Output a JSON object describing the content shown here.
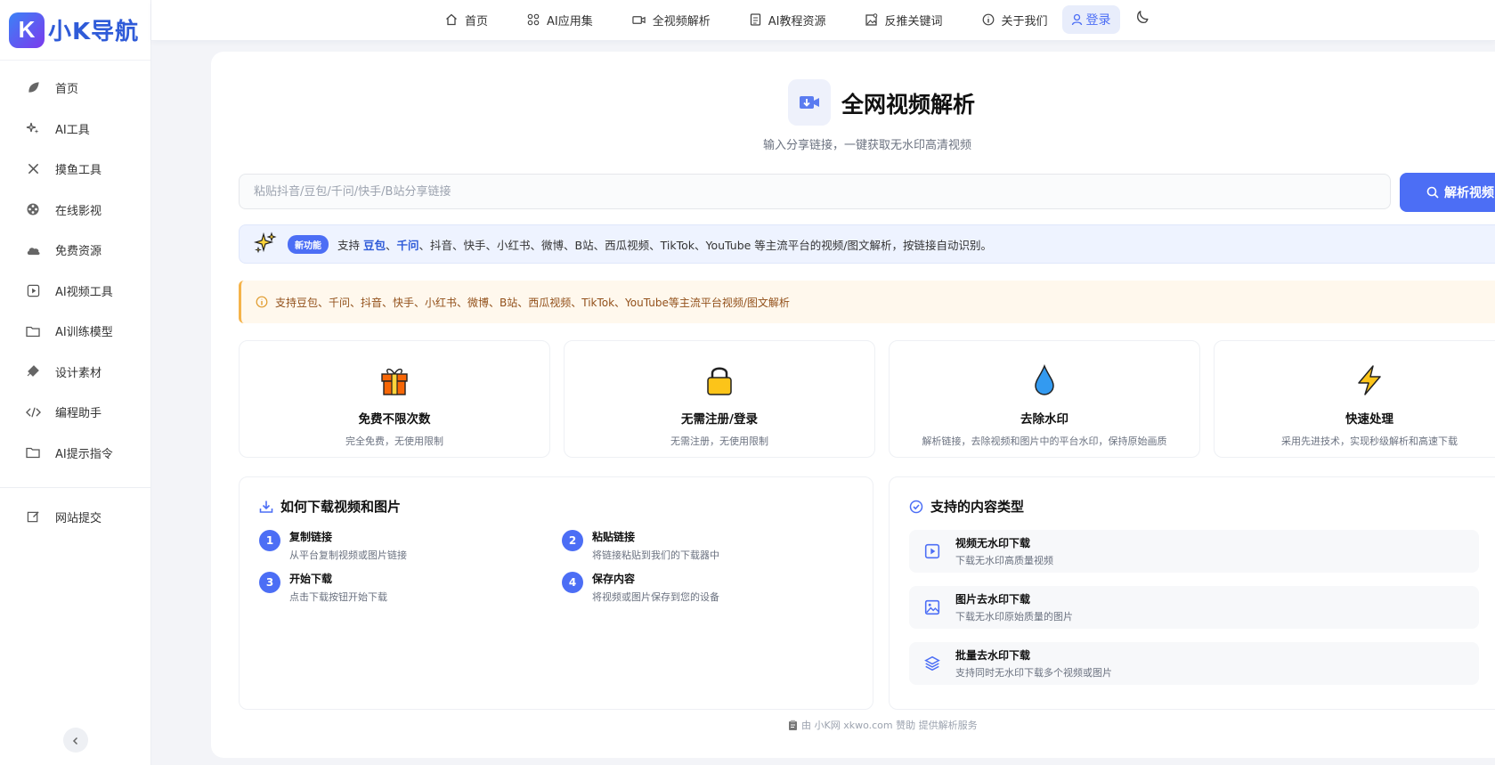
{
  "brand": {
    "name": "小K导航",
    "mark": "K"
  },
  "sidebar": {
    "items": [
      {
        "label": "首页",
        "icon": "leaf-icon"
      },
      {
        "label": "AI工具",
        "icon": "sparkle-icon"
      },
      {
        "label": "摸鱼工具",
        "icon": "tools-icon"
      },
      {
        "label": "在线影视",
        "icon": "film-reel-icon"
      },
      {
        "label": "免费资源",
        "icon": "cloud-icon"
      },
      {
        "label": "AI视频工具",
        "icon": "play-square-icon"
      },
      {
        "label": "AI训练模型",
        "icon": "folder-icon"
      },
      {
        "label": "设计素材",
        "icon": "palette-icon"
      },
      {
        "label": "编程助手",
        "icon": "code-icon"
      },
      {
        "label": "AI提示指令",
        "icon": "folder-icon"
      }
    ],
    "submit": {
      "label": "网站提交",
      "icon": "edit-icon"
    }
  },
  "topnav": {
    "items": [
      {
        "label": "首页",
        "icon": "home-icon"
      },
      {
        "label": "AI应用集",
        "icon": "grid-icon"
      },
      {
        "label": "全视频解析",
        "icon": "video-icon"
      },
      {
        "label": "AI教程资源",
        "icon": "document-icon"
      },
      {
        "label": "反推关键词",
        "icon": "image-search-icon"
      },
      {
        "label": "关于我们",
        "icon": "info-icon"
      }
    ],
    "login": "登录"
  },
  "hero": {
    "title": "全网视频解析",
    "subtitle": "输入分享链接，一键获取无水印高清视频"
  },
  "search": {
    "placeholder": "粘贴抖音/豆包/千问/快手/B站分享链接",
    "value": "",
    "button": "解析视频"
  },
  "notice": {
    "badge": "新功能",
    "prefix": "支持",
    "hl1": "豆包",
    "sep1": "、",
    "hl2": "千问",
    "rest": "、抖音、快手、小红书、微博、B站、西瓜视频、TikTok、YouTube 等主流平台的视频/图文解析，按链接自动识别。"
  },
  "tip": "支持豆包、千问、抖音、快手、小红书、微博、B站、西瓜视频、TikTok、YouTube等主流平台视频/图文解析",
  "features": [
    {
      "title": "免费不限次数",
      "desc": "完全免费，无使用限制",
      "icon": "gift-icon"
    },
    {
      "title": "无需注册/登录",
      "desc": "无需注册，无使用限制",
      "icon": "lock-icon"
    },
    {
      "title": "去除水印",
      "desc": "解析链接，去除视频和图片中的平台水印，保持原始画质",
      "icon": "droplet-icon"
    },
    {
      "title": "快速处理",
      "desc": "采用先进技术，实现秒级解析和高速下载",
      "icon": "lightning-icon"
    }
  ],
  "howto": {
    "title": "如何下载视频和图片",
    "steps": [
      {
        "num": "1",
        "title": "复制链接",
        "desc": "从平台复制视频或图片链接"
      },
      {
        "num": "2",
        "title": "粘贴链接",
        "desc": "将链接粘贴到我们的下载器中"
      },
      {
        "num": "3",
        "title": "开始下载",
        "desc": "点击下载按钮开始下载"
      },
      {
        "num": "4",
        "title": "保存内容",
        "desc": "将视频或图片保存到您的设备"
      }
    ]
  },
  "content_types": {
    "title": "支持的内容类型",
    "items": [
      {
        "title": "视频无水印下载",
        "desc": "下载无水印高质量视频",
        "icon": "play-square-icon"
      },
      {
        "title": "图片去水印下载",
        "desc": "下载无水印原始质量的图片",
        "icon": "image-icon"
      },
      {
        "title": "批量去水印下载",
        "desc": "支持同时无水印下载多个视频或图片",
        "icon": "layers-icon"
      }
    ]
  },
  "footer": "由 小K网 xkwo.com 赞助 提供解析服务",
  "colors": {
    "accent": "#4c6ef5",
    "brand": "#2f5bd8",
    "tip_bg": "#fff8ed",
    "notice_bg": "#eef3ff"
  }
}
